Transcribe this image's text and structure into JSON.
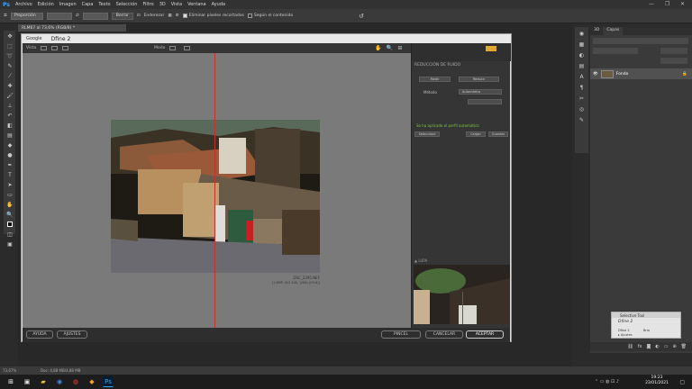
{
  "menubar": {
    "logo": "Ps",
    "items": [
      "Archivo",
      "Edición",
      "Imagen",
      "Capa",
      "Texto",
      "Selección",
      "Filtro",
      "3D",
      "Vista",
      "Ventana",
      "Ayuda"
    ],
    "controls": [
      "—",
      "❐",
      "✕"
    ]
  },
  "options": {
    "preset": "Proporción",
    "clear_label": "Borrar",
    "straighten_label": "Enderezar",
    "delete_cropped_label": "Eliminar píxeles recortados",
    "content_aware_label": "Según el contenido"
  },
  "doc": {
    "tab_title": "RLM67 al 73,6% (RGB/8) *"
  },
  "dialog": {
    "brand": "Google",
    "title": "Dfine 2",
    "preview": {
      "view_label": "Vista",
      "mode_label": "Modo",
      "photo_caption_1": "DSC_2395.NEF",
      "photo_caption_2": "[1,6MP, ISO 100, 1/60s (f/5.6)]"
    },
    "right_panel": {
      "section": "REDUCCIÓN DE RUIDO",
      "measure_btn": "Medir",
      "reduce_btn": "Reducir",
      "method_label": "Método",
      "method_value": "Automático",
      "status": "Se ha aplicado el perfil automático",
      "select_btn": "Seleccione",
      "load_btn": "Cargar",
      "save_btn": "Guardar",
      "loupe_label": "▲ LUPA"
    },
    "buttons": {
      "help": "AYUDA",
      "settings": "AJUSTES",
      "brush": "PINCEL",
      "cancel": "CANCELAR",
      "accept": "ACEPTAR"
    }
  },
  "layers_panel": {
    "tab1": "3D",
    "tab2": "Capas",
    "layer_name": "Fondo"
  },
  "selective_tool": {
    "title": "Selective Tool",
    "product": "Dfine 2",
    "line1": "Dfine 2",
    "line2": "Brio",
    "line3": "▸ Ajustes"
  },
  "statusbar": {
    "zoom": "73,67%",
    "doc_info": "Doc: 4,88 MB/4,88 MB"
  },
  "taskbar": {
    "time": "19:23",
    "date": "23/01/2021"
  }
}
